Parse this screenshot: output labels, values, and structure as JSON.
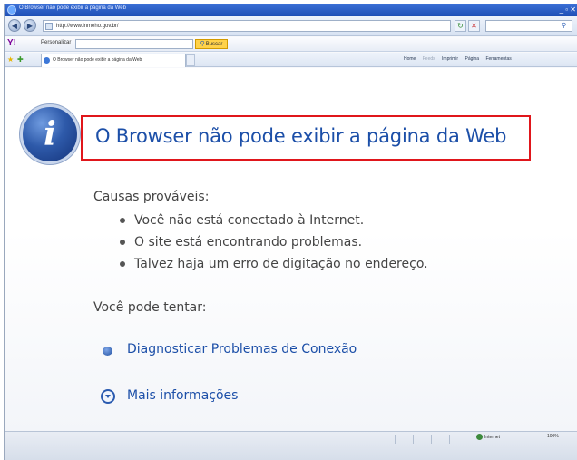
{
  "window": {
    "title": "O Browser não pode exibir a página da Web",
    "controls": "_ ▫ ✕"
  },
  "address_bar": {
    "url": "http://www.inmeho.gov.br/",
    "refresh": "↻",
    "stop": "✕"
  },
  "toolbar": {
    "yahoo": "Y!",
    "personalize": "Personalizar",
    "search_button": "Buscar"
  },
  "tabs": {
    "active_label": "O Browser não pode exibir a página da Web"
  },
  "command_bar": {
    "items": [
      "Home",
      "Feeds",
      "Imprimir",
      "Página",
      "Ferramentas"
    ]
  },
  "content": {
    "title": "O Browser não pode exibir a página da Web",
    "causes_heading": "Causas prováveis:",
    "causes": [
      "Você não está conectado à Internet.",
      "O site está encontrando problemas.",
      "Talvez haja um erro de digitação no endereço."
    ],
    "try_heading": "Você pode tentar:",
    "diagnose_link": "Diagnosticar Problemas de Conexão",
    "more_info_link": "Mais informações"
  },
  "status_bar": {
    "zone": "Internet",
    "zoom": "100%"
  },
  "colors": {
    "title_blue": "#1c4fa8",
    "highlight_red": "#e0161b"
  }
}
